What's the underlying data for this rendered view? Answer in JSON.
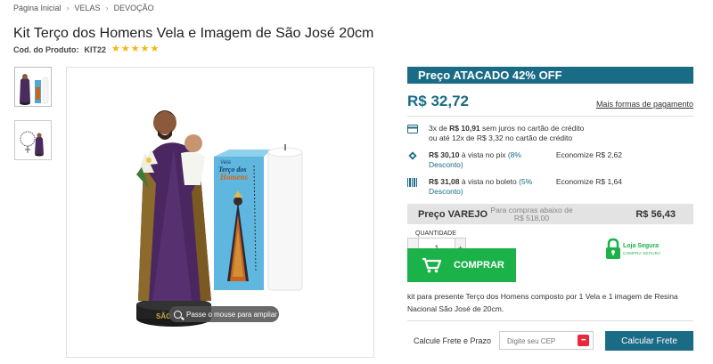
{
  "breadcrumb": {
    "items": [
      "Página Inicial",
      "VELAS",
      "DEVOÇÃO"
    ],
    "separator": "›"
  },
  "product": {
    "title": "Kit Terço dos Homens Vela e Imagem de São José 20cm",
    "code_label": "Cod. do Produto:",
    "code_value": "KIT22",
    "rating_stars": 5,
    "zoom_hint": "Passe o mouse para ampliar",
    "description": "kit para presente Terço dos Homens composto por 1 Vela e 1 imagem de Resina Nacional São José de 20cm."
  },
  "pricing": {
    "wholesale_banner": "Preço ATACADO 42% OFF",
    "price": "R$ 32,72",
    "more_payments": "Mais formas de pagamento",
    "installments_pre": "3x de ",
    "installments_value": "R$ 10,91",
    "installments_post": " sem juros no cartão de crédito",
    "installments_alt": "ou até 12x de R$ 3,32 no cartão de crédito",
    "pix_value": "R$ 30,10",
    "pix_text": " à vista no pix ",
    "pix_discount": "(8% Desconto)",
    "pix_savings": "Economize R$ 2,62",
    "boleto_value": "R$ 31,08",
    "boleto_text": " à vista no boleto ",
    "boleto_discount": "(5% Desconto)",
    "boleto_savings": "Economize R$ 1,64",
    "retail_label": "Preço VAREJO",
    "retail_note": "Para compras abaixo de R$ 518,00",
    "retail_price": "R$ 56,43"
  },
  "quantity": {
    "label": "QUANTIDADE",
    "value": "1",
    "minus": "-",
    "plus": "+"
  },
  "buy_button": "COMPRAR",
  "secure_badge": {
    "title": "Loja Segura",
    "subtitle": "COMPRA SEGURA"
  },
  "freight": {
    "label": "Calcule Frete e Prazo",
    "placeholder": "Digite seu CEP",
    "button": "Calcular Frete"
  },
  "colors": {
    "accent": "#1a6b86",
    "buy": "#1cb24a",
    "star": "#f6b40e",
    "cep_icon": "#e8283b"
  }
}
